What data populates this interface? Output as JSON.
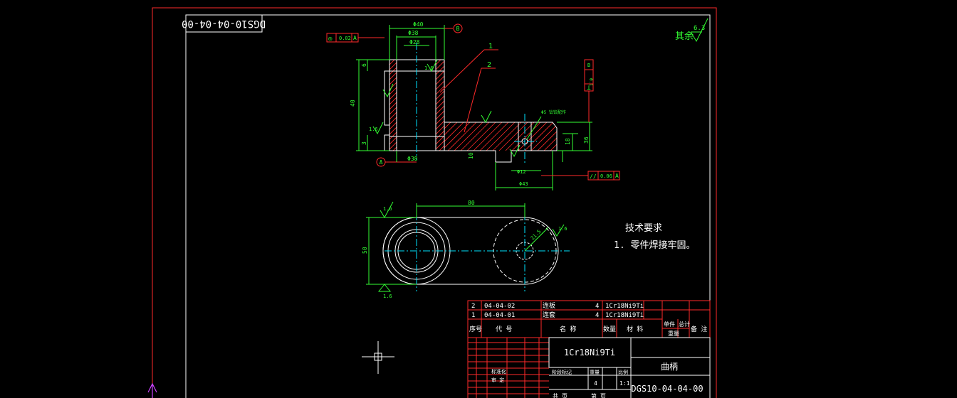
{
  "drawing": {
    "frame_code": "DGS10-04-04-00",
    "finish_label": "其余",
    "finish_value": "6.3",
    "tech": {
      "title": "技术要求",
      "note": "1. 零件焊接牢固。"
    },
    "leaders": [
      "1",
      "2"
    ],
    "datums": [
      "A",
      "B"
    ],
    "tolerance_top": {
      "symbol": "◎",
      "value": "0.02",
      "datum": "A"
    },
    "tolerance_bottom": {
      "symbol": "//",
      "value": "0.06",
      "datum": "A"
    },
    "tolerance_side": {
      "symbol": "⊥",
      "value": "0.1",
      "datum": "B"
    },
    "dims": {
      "d40": "Φ40",
      "d38_top": "Φ38",
      "d28": "Φ28",
      "d38_bottom": "Φ38",
      "h40": "40",
      "h6": "6",
      "h3": "3",
      "r10": "10",
      "h18": "18",
      "h36": "36",
      "d12": "Φ12",
      "d43": "Φ43",
      "hole_note": "Φ5  钻铰配作",
      "len80": "80",
      "w50": "50",
      "r21": "21.5",
      "ra16_a": "1.6",
      "ra16_b": "1.6",
      "ra16_c": "1.6",
      "ra16_d": "1.6",
      "ra16_e": "1.6"
    }
  },
  "title_block": {
    "parts": [
      {
        "no": "2",
        "code": "04-04-02",
        "name": "连板",
        "qty": "4",
        "material": "1Cr18Ni9Ti"
      },
      {
        "no": "1",
        "code": "04-04-01",
        "name": "连套",
        "qty": "4",
        "material": "1Cr18Ni9Ti"
      }
    ],
    "headers": {
      "no": "序号",
      "code": "代  号",
      "name": "名  称",
      "qty": "数量",
      "material": "材  料",
      "unit_weight": "单件",
      "total_weight": "总计",
      "weight": "重量",
      "remark": "备 注"
    },
    "material": "1Cr18Ni9Ti",
    "drawing_name": "曲柄",
    "drawing_number": "DGS10-04-04-00",
    "stage_label": "阶段标记",
    "weight_label": "重量",
    "scale_label": "比例",
    "count": "4",
    "scale": "1:1",
    "standard_label": "标准化",
    "approve_label": "审 定",
    "sheet_total": "共  页",
    "sheet_no": "第  页"
  },
  "colors": {
    "background": "#000000",
    "frame": "#ff2a2a",
    "geometry": "#ffffff",
    "dimension": "#33ff33",
    "centerline": "#00e5ff",
    "ucs": "#cc44ff"
  }
}
